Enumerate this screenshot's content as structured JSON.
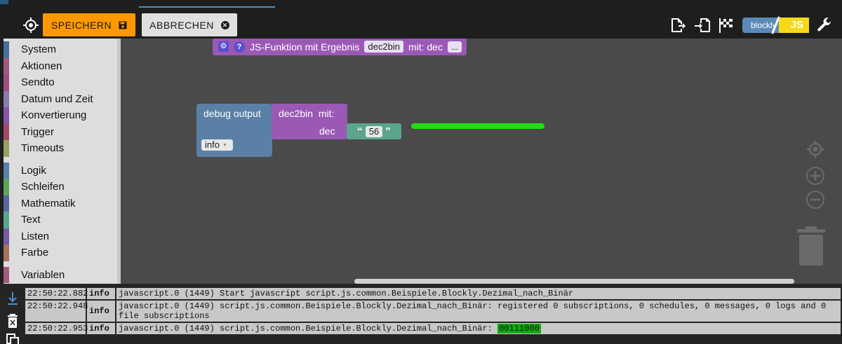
{
  "toolbar": {
    "save_label": "SPEICHERN",
    "cancel_label": "ABBRECHEN",
    "logo_left": "blockly",
    "logo_right": "JS"
  },
  "categories": [
    {
      "label": "System",
      "color": "#4a6f9a"
    },
    {
      "label": "Aktionen",
      "color": "#a05a80"
    },
    {
      "label": "Sendto",
      "color": "#9c4f7e"
    },
    {
      "label": "Datum und Zeit",
      "color": "#8a7aab"
    },
    {
      "label": "Konvertierung",
      "color": "#8855aa"
    },
    {
      "label": "Trigger",
      "color": "#a04a6a"
    },
    {
      "label": "Timeouts",
      "color": "#9aa060"
    },
    {
      "label": "Logik",
      "color": "#5b80a5"
    },
    {
      "label": "Schleifen",
      "color": "#5ba55b"
    },
    {
      "label": "Mathematik",
      "color": "#5b67a5"
    },
    {
      "label": "Text",
      "color": "#5ba58c"
    },
    {
      "label": "Listen",
      "color": "#745ba5"
    },
    {
      "label": "Farbe",
      "color": "#a5745b"
    },
    {
      "label": "Variablen",
      "color": "#a55b80"
    }
  ],
  "workspace": {
    "function_block": {
      "text": "JS-Funktion mit Ergebnis",
      "name": "dec2bin",
      "param_text": "mit: dec",
      "more": "..."
    },
    "debug_block": {
      "label": "debug output",
      "level": "info"
    },
    "call_block": {
      "label": "dec2bin  mit:",
      "param": "dec"
    },
    "text_block": {
      "open_quote": "“",
      "value": "56",
      "close_quote": "”"
    }
  },
  "log": [
    {
      "time": "22:50:22.882",
      "level": "info",
      "message": "javascript.0 (1449) Start javascript script.js.common.Beispiele.Blockly.Dezimal_nach_Binär",
      "highlight": ""
    },
    {
      "time": "22:50:22.948",
      "level": "info",
      "message": "javascript.0 (1449) script.js.common.Beispiele.Blockly.Dezimal_nach_Binär: registered 0 subscriptions, 0 schedules, 0 messages, 0 logs and 0 file subscriptions",
      "highlight": ""
    },
    {
      "time": "22:50:22.953",
      "level": "info",
      "message": "javascript.0 (1449) script.js.common.Beispiele.Blockly.Dezimal_nach_Binär: ",
      "highlight": "00111000"
    }
  ],
  "colors": {
    "save": "#ff9800",
    "workspace": "#4a4a4a",
    "procedure": "#9b59b6",
    "debug": "#5b80a5",
    "text": "#5ba58c",
    "highlight": "#22dd11"
  }
}
